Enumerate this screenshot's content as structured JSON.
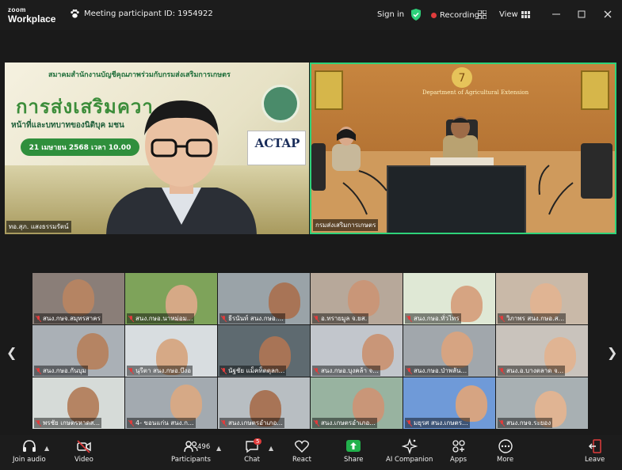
{
  "app": {
    "logo_line1": "zoom",
    "logo_line2": "Workplace"
  },
  "header": {
    "meeting_id": "Meeting participant ID: 1954922",
    "sign_in": "Sign in",
    "recording": "Recording",
    "view": "View"
  },
  "colors": {
    "accent_green": "#2ed27a",
    "record_red": "#e03c3c",
    "share_green": "#22b14c"
  },
  "left_tile": {
    "slide_header": "สมาคมสำนักงานบัญชีคุณภาพร่วมกับกรมส่งเสริมการเกษตร",
    "slide_title": "การส่งเสริมควา",
    "slide_subtitle": "หน้าที่และบทบาทของนิติบุค                               มชน",
    "slide_date": "21 เมษายน 2568 เวลา 10.00",
    "actap": "ACTAP",
    "name": "ทอ.สุภ. แสงธรรมรัตน์"
  },
  "right_tile": {
    "sign": "Department of Agricultural Extension",
    "name": "กรมส่งเสริมการเกษตร"
  },
  "gallery": [
    {
      "name": "สนง.กษจ.สมุทรสาคร"
    },
    {
      "name": "สนง.กษอ.นาหม่อม..."
    },
    {
      "name": "ธีรนันท์ สนง.กษอ...."
    },
    {
      "name": "อ.ทรายมูล จ.ยส."
    },
    {
      "name": "สนง.กษอ.ทั่วไทร"
    },
    {
      "name": "วิภาพร สนง.กษอ.ส..."
    },
    {
      "name": "สนง.กษอ.กันบุม"
    },
    {
      "name": "นุรีตา สนง.กษอ.บึงอ"
    },
    {
      "name": "นัฐชัย แม็คท็ตตุลก..."
    },
    {
      "name": "สนง.กษอ.บุงคล้า จ..."
    },
    {
      "name": "สนง.กษอ.ป่าพลัน..."
    },
    {
      "name": "สนง.อ.บางตลาด จ..."
    },
    {
      "name": "พรชัย เกษตรหาดส..."
    },
    {
      "name": "4- ขอนแก่น สนง.ก..."
    },
    {
      "name": "สนง.เกษตรอำเภอ..."
    },
    {
      "name": "สนง.เกษตรอำเภอ..."
    },
    {
      "name": "มยุรศ สนง.เกษตร..."
    },
    {
      "name": "สนง.กษจ.ระยอง"
    }
  ],
  "toolbar": {
    "join_audio": "Join audio",
    "video": "Video",
    "participants": "Participants",
    "participants_count": "496",
    "chat": "Chat",
    "chat_badge": "5",
    "react": "React",
    "share": "Share",
    "ai_companion": "AI Companion",
    "apps": "Apps",
    "more": "More",
    "leave": "Leave"
  }
}
